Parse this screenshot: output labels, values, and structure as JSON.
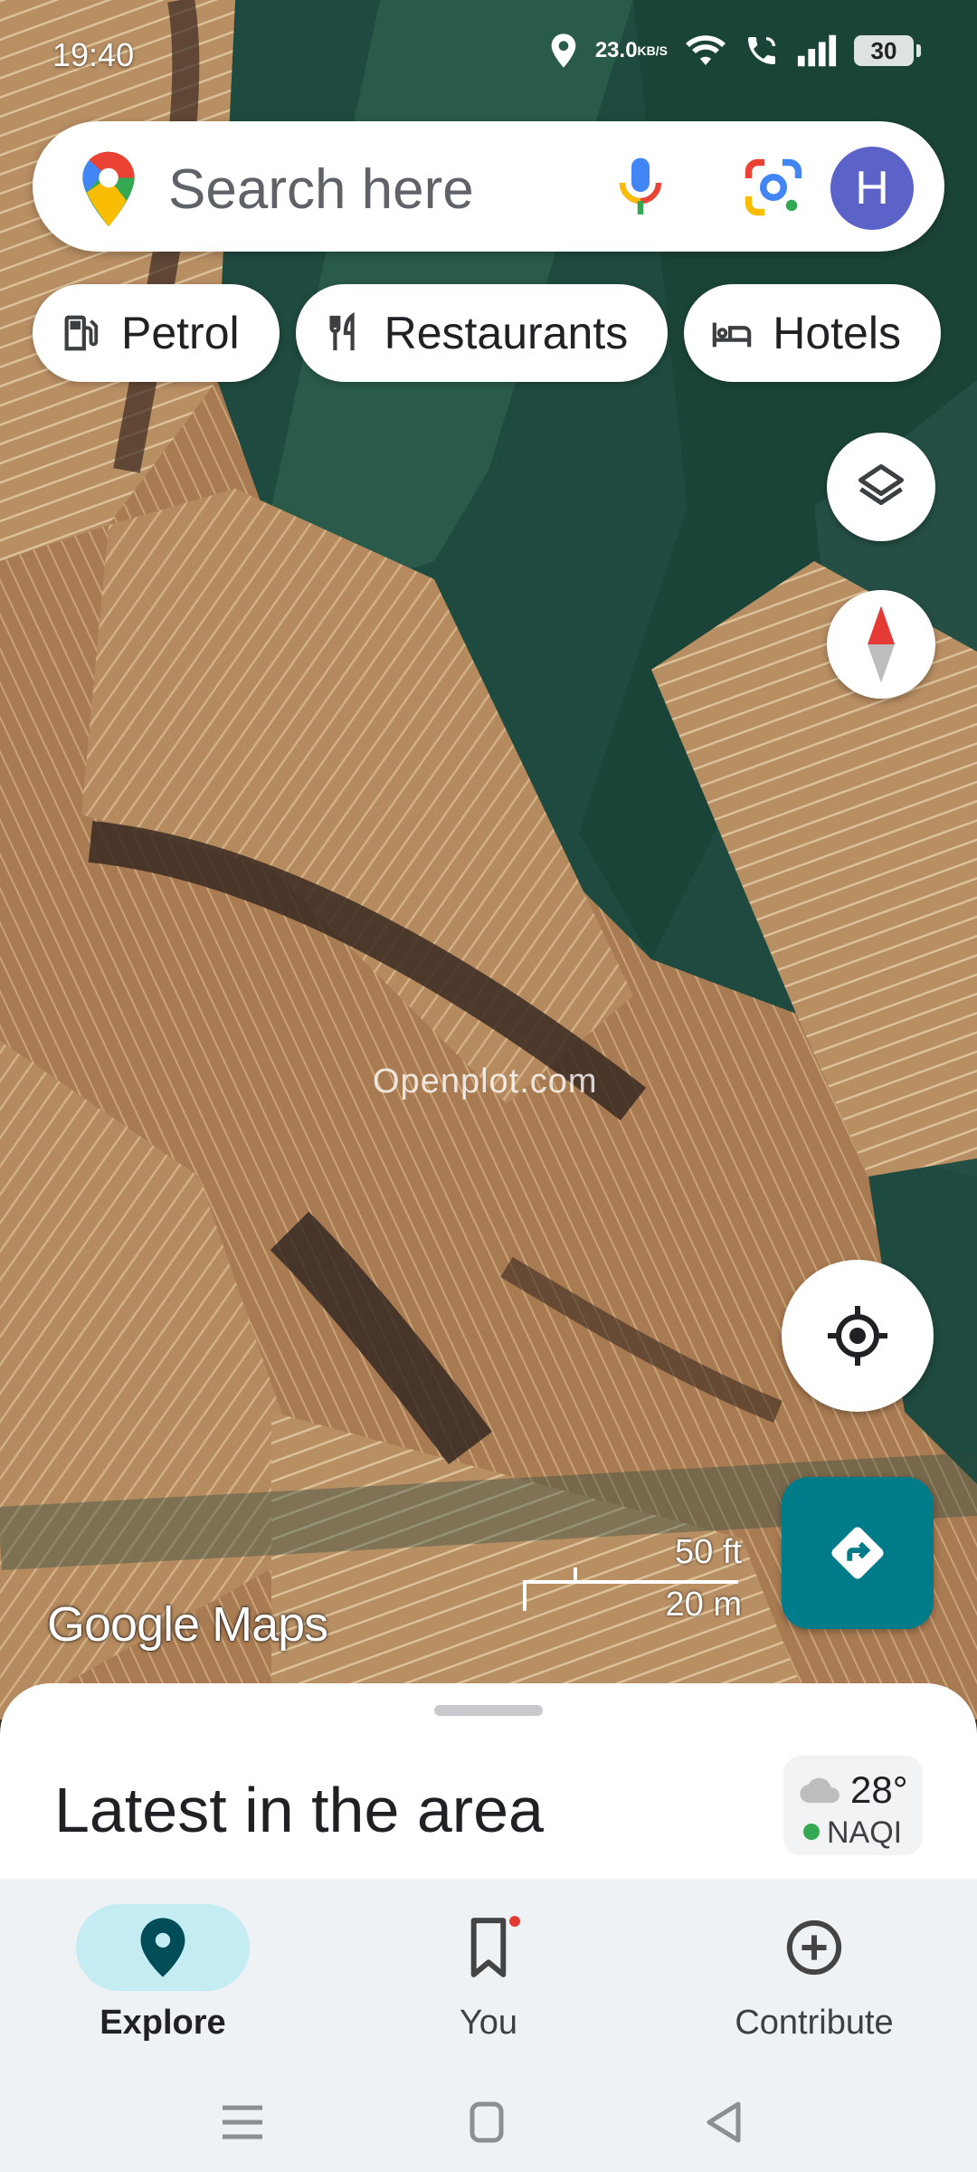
{
  "status_bar": {
    "time": "19:40",
    "net_speed_value": "23.0",
    "net_speed_unit": "KB/S",
    "battery": "30",
    "icons": [
      "location-icon",
      "wifi-icon",
      "wifi-call-icon",
      "signal-icon",
      "battery-icon"
    ]
  },
  "search": {
    "placeholder": "Search here",
    "avatar_initial": "H",
    "icons": [
      "google-maps-pin-icon",
      "microphone-icon",
      "google-lens-icon"
    ]
  },
  "chips": [
    {
      "label": "Petrol",
      "icon": "fuel-pump-icon"
    },
    {
      "label": "Restaurants",
      "icon": "fork-knife-icon"
    },
    {
      "label": "Hotels",
      "icon": "bed-icon"
    }
  ],
  "map": {
    "watermark": "Openplot.com",
    "logo": "Google Maps",
    "scale_ft": "50 ft",
    "scale_m": "20 m"
  },
  "sheet": {
    "title": "Latest in the area",
    "weather_temp": "28°",
    "aqi_label": "NAQI"
  },
  "bottom_nav": {
    "items": [
      {
        "label": "Explore",
        "icon": "location-pin-icon",
        "active": true
      },
      {
        "label": "You",
        "icon": "bookmark-icon",
        "active": false
      },
      {
        "label": "Contribute",
        "icon": "add-circle-icon",
        "active": false
      }
    ]
  },
  "colors": {
    "accent": "#007b8a",
    "avatar": "#5b63c9",
    "active_pill": "#c4ecf3",
    "aqi_good": "#34a853"
  }
}
